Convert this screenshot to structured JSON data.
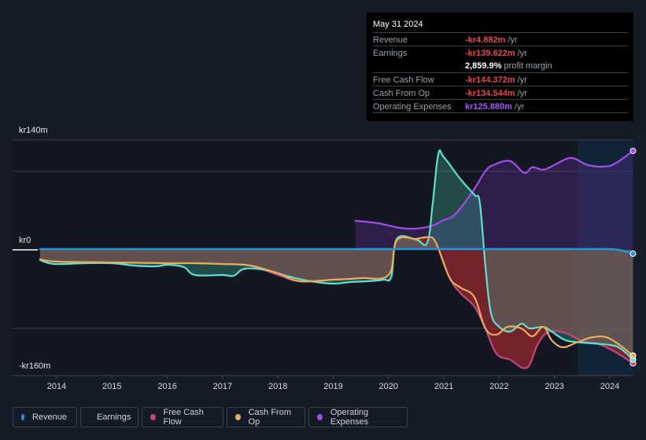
{
  "tooltip": {
    "date": "May 31 2024",
    "rows": [
      {
        "label": "Revenue",
        "value": "-kr4.882m",
        "unit": "/yr",
        "color": "#e5484d"
      },
      {
        "label": "Earnings",
        "value": "-kr139.622m",
        "unit": "/yr",
        "color": "#e5484d"
      },
      {
        "label": "",
        "value": "2,859.9%",
        "unit": "profit margin",
        "color": "#ffffff"
      },
      {
        "label": "Free Cash Flow",
        "value": "-kr144.372m",
        "unit": "/yr",
        "color": "#e5484d"
      },
      {
        "label": "Cash From Op",
        "value": "-kr134.544m",
        "unit": "/yr",
        "color": "#e5484d"
      },
      {
        "label": "Operating Expenses",
        "value": "kr125.880m",
        "unit": "/yr",
        "color": "#a45bf0"
      }
    ]
  },
  "legend": [
    {
      "label": "Revenue",
      "color": "#2394df"
    },
    {
      "label": "Earnings",
      "color": "#5ce1cf"
    },
    {
      "label": "Free Cash Flow",
      "color": "#c8437e"
    },
    {
      "label": "Cash From Op",
      "color": "#e9ac5b"
    },
    {
      "label": "Operating Expenses",
      "color": "#9f4ee6"
    }
  ],
  "chart_data": {
    "type": "line",
    "title": "",
    "xlabel": "",
    "ylabel": "",
    "currency_unit": "kr m",
    "y_tick_labels": [
      "kr140m",
      "kr0",
      "-kr160m"
    ],
    "y_ticks": [
      140,
      0,
      -160
    ],
    "ylim": [
      -160,
      140
    ],
    "x_tick_labels": [
      "2014",
      "2015",
      "2016",
      "2017",
      "2018",
      "2019",
      "2020",
      "2021",
      "2022",
      "2023",
      "2024"
    ],
    "xlim": [
      2013.75,
      2024.42
    ],
    "forecast_highlight_start": 2023.4,
    "grid": true,
    "legend_position": "bottom",
    "series": [
      {
        "name": "Revenue",
        "color": "#2394df",
        "x": [
          2013.7,
          2016,
          2019,
          2020.9,
          2022,
          2023.5,
          2024.1,
          2024.42
        ],
        "y": [
          1,
          1,
          1,
          1,
          1,
          1,
          0.5,
          -4.9
        ]
      },
      {
        "name": "Earnings",
        "color": "#5ce1cf",
        "x": [
          2013.7,
          2013.95,
          2014.5,
          2015,
          2015.4,
          2015.8,
          2016,
          2016.3,
          2016.5,
          2017,
          2017.2,
          2017.4,
          2017.8,
          2018.2,
          2018.6,
          2019,
          2019.3,
          2019.6,
          2019.9,
          2020.05,
          2020.15,
          2020.5,
          2020.7,
          2020.8,
          2020.9,
          2021.0,
          2021.3,
          2021.55,
          2021.65,
          2021.75,
          2021.85,
          2022.0,
          2022.2,
          2022.4,
          2022.55,
          2022.8,
          2022.95,
          2023.2,
          2023.5,
          2024.0,
          2024.2,
          2024.42
        ],
        "y": [
          -13,
          -18,
          -17,
          -17,
          -20,
          -21,
          -19,
          -22,
          -32,
          -32,
          -33,
          -24,
          -26,
          -34,
          -40,
          -43,
          -41,
          -40,
          -38,
          -34,
          14,
          13,
          9,
          60,
          122,
          118,
          90,
          70,
          60,
          -20,
          -80,
          -98,
          -104,
          -94,
          -100,
          -98,
          -104,
          -115,
          -118,
          -121,
          -126,
          -139.6
        ]
      },
      {
        "name": "Free Cash Flow",
        "color": "#c8437e",
        "x": [
          2013.7,
          2014,
          2015,
          2016,
          2016.5,
          2017,
          2017.5,
          2018,
          2018.4,
          2019,
          2019.5,
          2020,
          2020.15,
          2020.5,
          2020.7,
          2020.85,
          2021.1,
          2021.3,
          2021.55,
          2021.75,
          2021.95,
          2022.2,
          2022.5,
          2022.7,
          2022.9,
          2023.2,
          2023.5,
          2023.8,
          2024.1,
          2024.42
        ],
        "y": [
          -12,
          -15,
          -16,
          -17,
          -17,
          -18,
          -20,
          -32,
          -40,
          -38,
          -36,
          -32,
          12,
          14,
          16,
          10,
          -35,
          -55,
          -72,
          -100,
          -132,
          -140,
          -150,
          -120,
          -104,
          -106,
          -116,
          -120,
          -130,
          -144.4
        ]
      },
      {
        "name": "Cash From Op",
        "color": "#e9ac5b",
        "x": [
          2013.7,
          2014,
          2015,
          2016,
          2016.5,
          2017,
          2017.5,
          2018,
          2018.4,
          2019,
          2019.5,
          2020,
          2020.15,
          2020.5,
          2020.7,
          2020.85,
          2021.1,
          2021.3,
          2021.55,
          2021.75,
          2021.95,
          2022.15,
          2022.4,
          2022.6,
          2022.8,
          2022.95,
          2023.15,
          2023.4,
          2023.7,
          2024.0,
          2024.42
        ],
        "y": [
          -12,
          -15,
          -16,
          -17,
          -17,
          -18,
          -20,
          -30,
          -40,
          -38,
          -36,
          -32,
          12,
          14,
          16,
          10,
          -35,
          -48,
          -60,
          -100,
          -108,
          -98,
          -100,
          -110,
          -98,
          -115,
          -124,
          -118,
          -111,
          -113,
          -134.5
        ]
      },
      {
        "name": "Operating Expenses",
        "color": "#9f4ee6",
        "x": [
          2019.4,
          2019.8,
          2020.2,
          2020.5,
          2020.8,
          2021.0,
          2021.2,
          2021.5,
          2021.75,
          2021.9,
          2022.2,
          2022.45,
          2022.6,
          2022.8,
          2023.0,
          2023.3,
          2023.6,
          2023.9,
          2024.1,
          2024.42
        ],
        "y": [
          37,
          34,
          28,
          27,
          31,
          38,
          45,
          72,
          100,
          108,
          113,
          98,
          105,
          102,
          108,
          117,
          108,
          106,
          110,
          125.9
        ]
      }
    ]
  }
}
